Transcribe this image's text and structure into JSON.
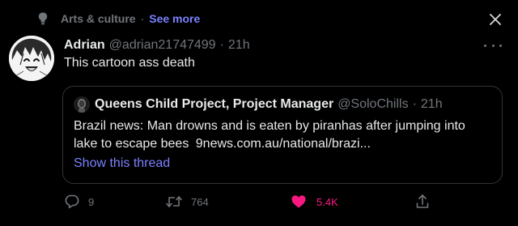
{
  "context": {
    "topic": "Arts & culture",
    "separator": "·",
    "see_more": "See more"
  },
  "tweet": {
    "author_name": "Adrian",
    "author_handle": "@adrian21747499",
    "separator": "·",
    "time": "21h",
    "text": "This cartoon ass death"
  },
  "quote": {
    "author_name": "Queens Child Project, Project Manager",
    "author_handle": "@SoloChills",
    "separator": "·",
    "time": "21h",
    "text": "Brazil news: Man drowns and is eaten by piranhas after jumping into lake to escape bees",
    "link": "9news.com.au/national/brazi...",
    "show_thread": "Show this thread"
  },
  "actions": {
    "replies": "9",
    "retweets": "764",
    "likes": "5.4K"
  },
  "icons": {
    "topic": "topic-pin-icon",
    "close": "close-icon",
    "more": "more-icon",
    "reply": "reply-icon",
    "retweet": "retweet-icon",
    "like": "heart-icon",
    "share": "share-icon"
  },
  "colors": {
    "background": "#000000",
    "text": "#e7e9ea",
    "muted": "#71767b",
    "accent": "#7a81ff",
    "like": "#f91880",
    "border": "#2f3336"
  }
}
